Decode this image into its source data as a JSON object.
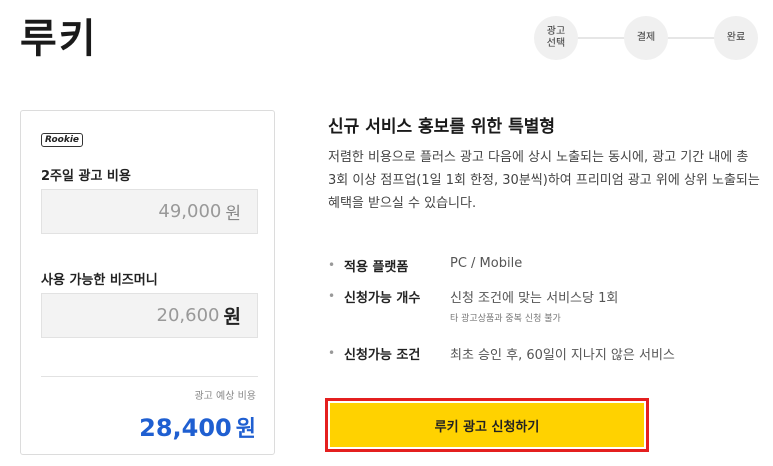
{
  "page": {
    "title": "루키"
  },
  "steps": [
    {
      "label": "광고 선택"
    },
    {
      "label": "결제"
    },
    {
      "label": "완료"
    }
  ],
  "summary": {
    "badge": "Rookie",
    "cost_label": "2주일 광고 비용",
    "cost_value": "49,000",
    "cost_unit": "원",
    "bizmoney_label": "사용 가능한 비즈머니",
    "bizmoney_value": "20,600",
    "bizmoney_unit": "원",
    "estimate_label": "광고 예상 비용",
    "estimate_value": "28,400",
    "estimate_unit": "원",
    "estimate_color": "#1f5fd1"
  },
  "content": {
    "title": "신규 서비스 홍보를 위한 특별형",
    "description": "저렴한 비용으로 플러스 광고 다음에 상시 노출되는 동시에, 광고 기간 내에 총 3회 이상 점프업(1일 1회 한정, 30분씩)하여 프리미엄 광고 위에 상위 노출되는 혜택을 받으실 수 있습니다.",
    "info": [
      {
        "key": "적용 플랫폼",
        "value": "PC / Mobile",
        "sub": ""
      },
      {
        "key": "신청가능 개수",
        "value": "신청 조건에 맞는 서비스당 1회",
        "sub": "타 광고상품과 중복 신청 불가"
      },
      {
        "key": "신청가능 조건",
        "value": "최초 승인 후, 60일이 지나지 않은 서비스",
        "sub": ""
      }
    ]
  },
  "apply_button": {
    "label": "루키 광고 신청하기",
    "bg_color": "#ffd200",
    "highlight_color": "#e41f1f"
  }
}
